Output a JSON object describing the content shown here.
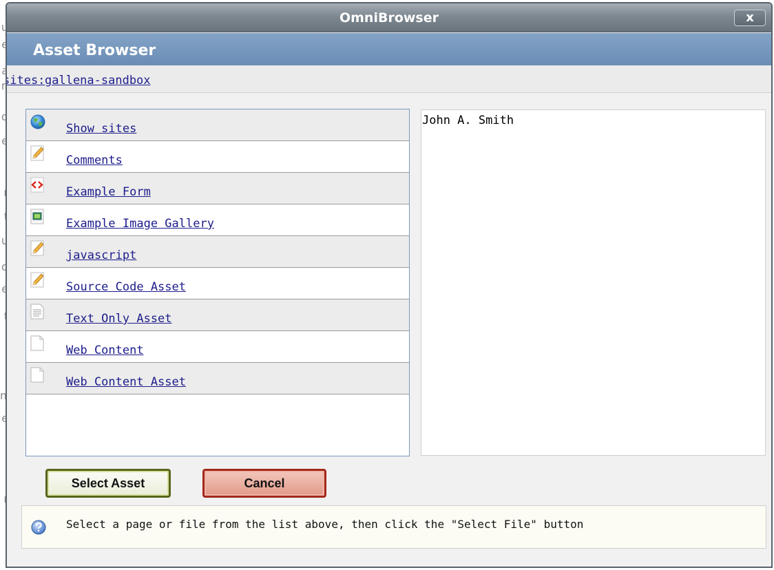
{
  "background_page": {
    "fragments": [
      "u",
      "e",
      "a",
      "n",
      "d",
      "e",
      "r",
      "t",
      "u",
      "d",
      "e",
      "t",
      "l",
      "m",
      "e",
      "r",
      "ii",
      "ii",
      "u",
      "a"
    ]
  },
  "window": {
    "title": "OmniBrowser",
    "close_label": "x"
  },
  "header": {
    "title": "Asset Browser"
  },
  "breadcrumb": {
    "prefix": "sites:",
    "site": "gallena-sandbox"
  },
  "assets": [
    {
      "label": "Show sites",
      "icon": "globe-icon"
    },
    {
      "label": "Comments",
      "icon": "pencil-icon"
    },
    {
      "label": "Example Form",
      "icon": "form-icon"
    },
    {
      "label": "Example Image Gallery",
      "icon": "image-icon"
    },
    {
      "label": "javascript",
      "icon": "pencil-icon"
    },
    {
      "label": "Source Code Asset",
      "icon": "pencil-icon"
    },
    {
      "label": "Text Only Asset",
      "icon": "text-document-icon"
    },
    {
      "label": "Web Content",
      "icon": "blank-document-icon"
    },
    {
      "label": "Web Content Asset",
      "icon": "blank-document-icon"
    }
  ],
  "preview": {
    "text": "John A. Smith"
  },
  "buttons": {
    "select": "Select Asset",
    "cancel": "Cancel"
  },
  "help": {
    "text": "Select a page or file from the list above, then click the \"Select File\" button",
    "icon": "question-icon"
  },
  "colors": {
    "titlebar": "#7e8891",
    "header": "#6a8db6",
    "link": "#1c1c8c",
    "select_border": "#56661c",
    "cancel_border": "#a4281a"
  }
}
